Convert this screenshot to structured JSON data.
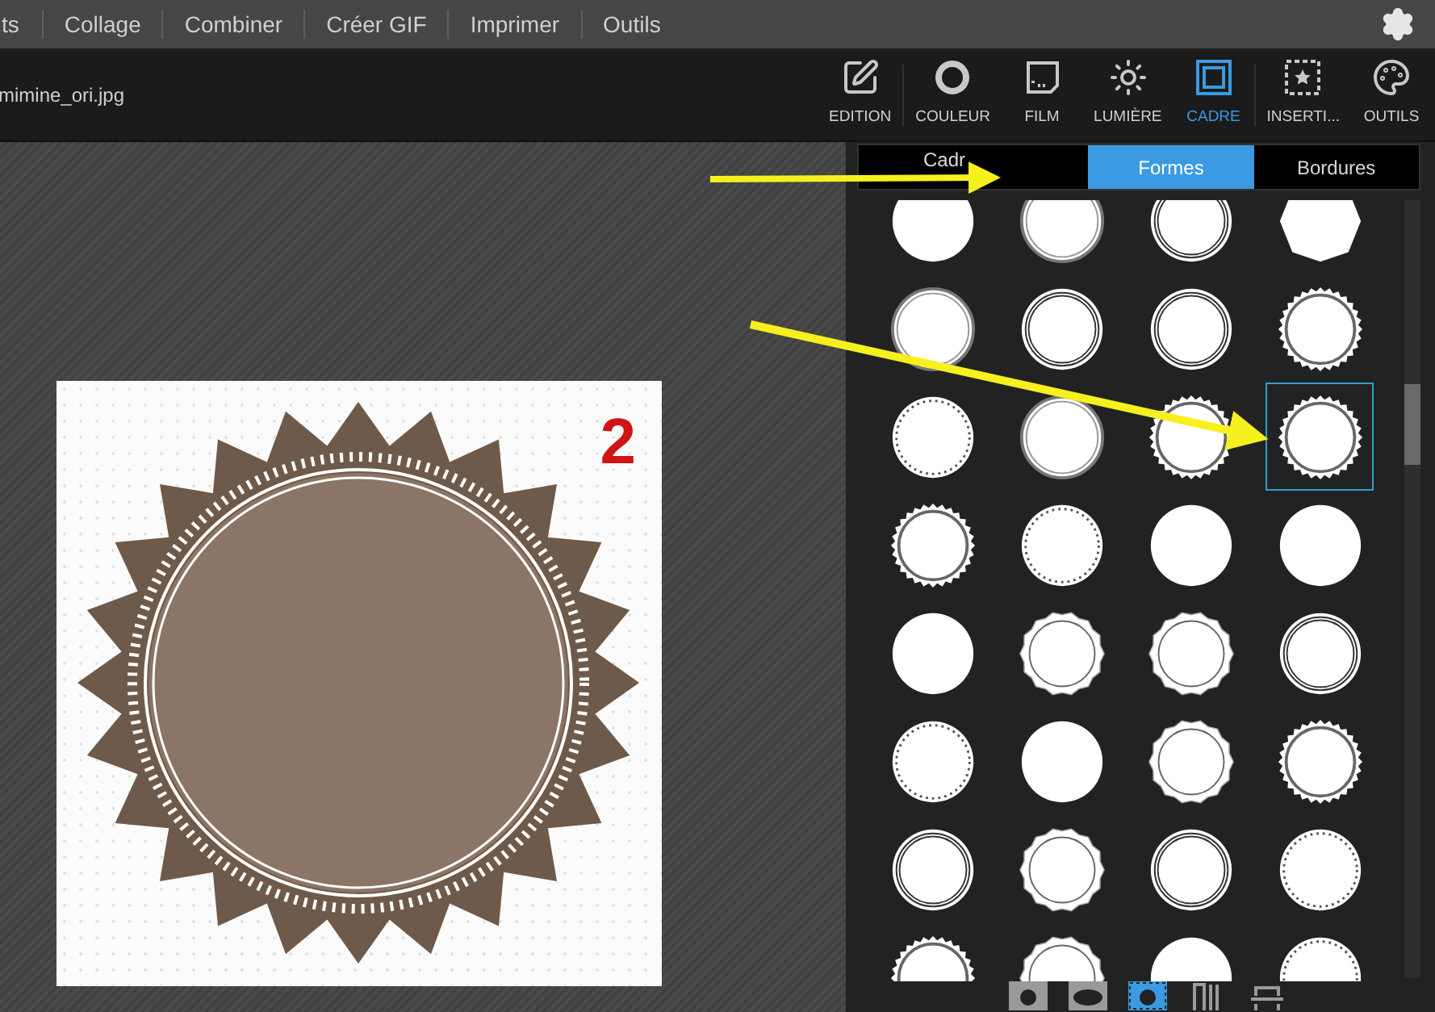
{
  "menu": [
    {
      "label": "ts"
    },
    {
      "label": "Collage"
    },
    {
      "label": "Combiner"
    },
    {
      "label": "Créer GIF"
    },
    {
      "label": "Imprimer"
    },
    {
      "label": "Outils"
    }
  ],
  "file_name": "mimine_ori.jpg",
  "toolbar": [
    {
      "label": "EDITION",
      "kind": "edit",
      "selected": false
    },
    {
      "label": "COULEUR",
      "kind": "color",
      "selected": false
    },
    {
      "label": "FILM",
      "kind": "film",
      "selected": false
    },
    {
      "label": "LUMIÈRE",
      "kind": "light",
      "selected": false
    },
    {
      "label": "CADRE",
      "kind": "frame",
      "selected": true
    },
    {
      "label": "INSERTI...",
      "kind": "insert",
      "selected": false
    },
    {
      "label": "OUTILS",
      "kind": "tools",
      "selected": false
    }
  ],
  "canvas": {
    "badge": "2"
  },
  "tabs": [
    {
      "label": "Cadr",
      "selected": false
    },
    {
      "label": "Formes",
      "selected": true
    },
    {
      "label": "Bordures",
      "selected": false
    }
  ],
  "shapes": [
    {
      "kind": "plain",
      "selected": false
    },
    {
      "kind": "ring",
      "selected": false
    },
    {
      "kind": "double",
      "selected": false
    },
    {
      "kind": "octagon",
      "selected": false
    },
    {
      "kind": "ring",
      "selected": false
    },
    {
      "kind": "double",
      "selected": false
    },
    {
      "kind": "double",
      "selected": false
    },
    {
      "kind": "serrated",
      "selected": false
    },
    {
      "kind": "dotted",
      "selected": false
    },
    {
      "kind": "ring",
      "selected": false
    },
    {
      "kind": "serrated",
      "selected": false
    },
    {
      "kind": "serrated",
      "selected": true
    },
    {
      "kind": "serrated",
      "selected": false
    },
    {
      "kind": "dotted",
      "selected": false
    },
    {
      "kind": "plain",
      "selected": false
    },
    {
      "kind": "plain",
      "selected": false
    },
    {
      "kind": "plain",
      "selected": false
    },
    {
      "kind": "scalloped",
      "selected": false
    },
    {
      "kind": "scalloped",
      "selected": false
    },
    {
      "kind": "double",
      "selected": false
    },
    {
      "kind": "dotted",
      "selected": false
    },
    {
      "kind": "plain",
      "selected": false
    },
    {
      "kind": "scalloped",
      "selected": false
    },
    {
      "kind": "serrated",
      "selected": false
    },
    {
      "kind": "double",
      "selected": false
    },
    {
      "kind": "scalloped",
      "selected": false
    },
    {
      "kind": "double",
      "selected": false
    },
    {
      "kind": "dotted",
      "selected": false
    },
    {
      "kind": "serrated",
      "selected": false
    },
    {
      "kind": "scalloped",
      "selected": false
    },
    {
      "kind": "plain",
      "selected": false
    },
    {
      "kind": "dotted",
      "selected": false
    }
  ],
  "shape_modes": [
    {
      "kind": "circle",
      "selected": false
    },
    {
      "kind": "ellipse",
      "selected": false
    },
    {
      "kind": "framed",
      "selected": true
    },
    {
      "kind": "vertical",
      "selected": false
    },
    {
      "kind": "horizontal",
      "selected": false
    }
  ]
}
